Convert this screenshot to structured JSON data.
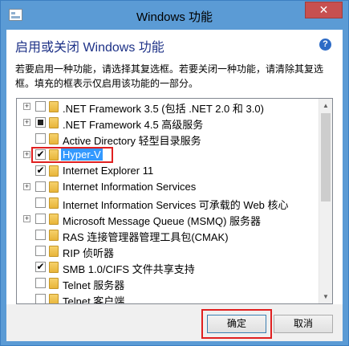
{
  "window": {
    "title": "Windows 功能",
    "close_glyph": "✕",
    "accent": "#5b9bd5"
  },
  "header": {
    "heading": "启用或关闭 Windows 功能",
    "help_glyph": "?",
    "description": "若要启用一种功能，请选择其复选框。若要关闭一种功能，请清除其复选框。填充的框表示仅启用该功能的一部分。"
  },
  "features": [
    {
      "label": ".NET Framework 3.5 (包括 .NET 2.0 和 3.0)",
      "expandable": true,
      "state": "unchecked"
    },
    {
      "label": ".NET Framework 4.5 高级服务",
      "expandable": true,
      "state": "partial"
    },
    {
      "label": "Active Directory 轻型目录服务",
      "expandable": false,
      "state": "unchecked"
    },
    {
      "label": "Hyper-V",
      "expandable": true,
      "state": "checked",
      "selected": true,
      "highlighted": true
    },
    {
      "label": "Internet Explorer 11",
      "expandable": false,
      "state": "checked"
    },
    {
      "label": "Internet Information Services",
      "expandable": true,
      "state": "unchecked"
    },
    {
      "label": "Internet Information Services 可承载的 Web 核心",
      "expandable": false,
      "state": "unchecked"
    },
    {
      "label": "Microsoft Message Queue (MSMQ) 服务器",
      "expandable": true,
      "state": "unchecked"
    },
    {
      "label": "RAS 连接管理器管理工具包(CMAK)",
      "expandable": false,
      "state": "unchecked"
    },
    {
      "label": "RIP 侦听器",
      "expandable": false,
      "state": "unchecked"
    },
    {
      "label": "SMB 1.0/CIFS 文件共享支持",
      "expandable": false,
      "state": "checked"
    },
    {
      "label": "Telnet 服务器",
      "expandable": false,
      "state": "unchecked"
    },
    {
      "label": "Telnet 客户端",
      "expandable": false,
      "state": "unchecked"
    }
  ],
  "glyphs": {
    "expander": "+",
    "check": "✔",
    "scroll_up": "▲",
    "scroll_down": "▼"
  },
  "footer": {
    "ok_label": "确定",
    "cancel_label": "取消"
  }
}
